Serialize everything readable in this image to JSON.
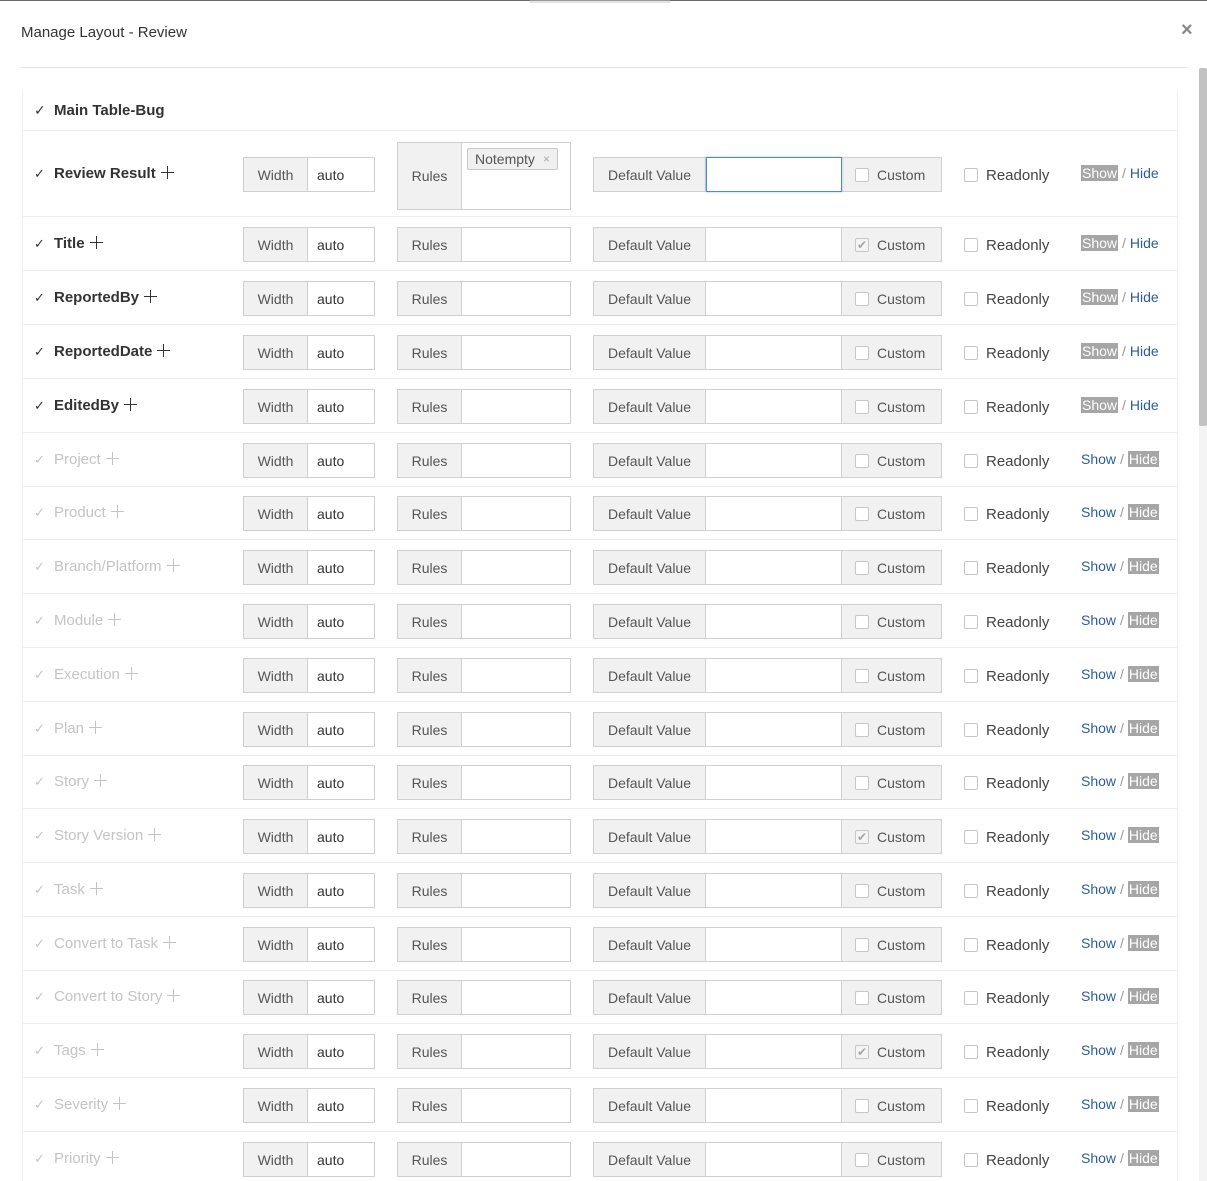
{
  "dialog": {
    "title": "Manage Layout - Review",
    "close_label": "×"
  },
  "section": {
    "title": "Main Table-Bug"
  },
  "labels": {
    "width": "Width",
    "rules": "Rules",
    "default_value": "Default Value",
    "custom": "Custom",
    "readonly": "Readonly",
    "show": "Show",
    "hide": "Hide",
    "separator": "/",
    "tick": "✓"
  },
  "rows": [
    {
      "name": "Review Result",
      "visible": true,
      "width": "auto",
      "rules": [
        "Notempty"
      ],
      "default_value": "",
      "custom": false,
      "readonly": false
    },
    {
      "name": "Title",
      "visible": true,
      "width": "auto",
      "rules": [],
      "default_value": "",
      "custom": true,
      "readonly": false
    },
    {
      "name": "ReportedBy",
      "visible": true,
      "width": "auto",
      "rules": [],
      "default_value": "",
      "custom": false,
      "readonly": false
    },
    {
      "name": "ReportedDate",
      "visible": true,
      "width": "auto",
      "rules": [],
      "default_value": "",
      "custom": false,
      "readonly": false
    },
    {
      "name": "EditedBy",
      "visible": true,
      "width": "auto",
      "rules": [],
      "default_value": "",
      "custom": false,
      "readonly": false
    },
    {
      "name": "Project",
      "visible": false,
      "width": "auto",
      "rules": [],
      "default_value": "",
      "custom": false,
      "readonly": false
    },
    {
      "name": "Product",
      "visible": false,
      "width": "auto",
      "rules": [],
      "default_value": "",
      "custom": false,
      "readonly": false
    },
    {
      "name": "Branch/Platform",
      "visible": false,
      "width": "auto",
      "rules": [],
      "default_value": "",
      "custom": false,
      "readonly": false
    },
    {
      "name": "Module",
      "visible": false,
      "width": "auto",
      "rules": [],
      "default_value": "",
      "custom": false,
      "readonly": false
    },
    {
      "name": "Execution",
      "visible": false,
      "width": "auto",
      "rules": [],
      "default_value": "",
      "custom": false,
      "readonly": false
    },
    {
      "name": "Plan",
      "visible": false,
      "width": "auto",
      "rules": [],
      "default_value": "",
      "custom": false,
      "readonly": false
    },
    {
      "name": "Story",
      "visible": false,
      "width": "auto",
      "rules": [],
      "default_value": "",
      "custom": false,
      "readonly": false
    },
    {
      "name": "Story Version",
      "visible": false,
      "width": "auto",
      "rules": [],
      "default_value": "",
      "custom": true,
      "readonly": false
    },
    {
      "name": "Task",
      "visible": false,
      "width": "auto",
      "rules": [],
      "default_value": "",
      "custom": false,
      "readonly": false
    },
    {
      "name": "Convert to Task",
      "visible": false,
      "width": "auto",
      "rules": [],
      "default_value": "",
      "custom": false,
      "readonly": false
    },
    {
      "name": "Convert to Story",
      "visible": false,
      "width": "auto",
      "rules": [],
      "default_value": "",
      "custom": false,
      "readonly": false
    },
    {
      "name": "Tags",
      "visible": false,
      "width": "auto",
      "rules": [],
      "default_value": "",
      "custom": true,
      "readonly": false
    },
    {
      "name": "Severity",
      "visible": false,
      "width": "auto",
      "rules": [],
      "default_value": "",
      "custom": false,
      "readonly": false
    },
    {
      "name": "Priority",
      "visible": false,
      "width": "auto",
      "rules": [],
      "default_value": "",
      "custom": false,
      "readonly": false
    }
  ]
}
